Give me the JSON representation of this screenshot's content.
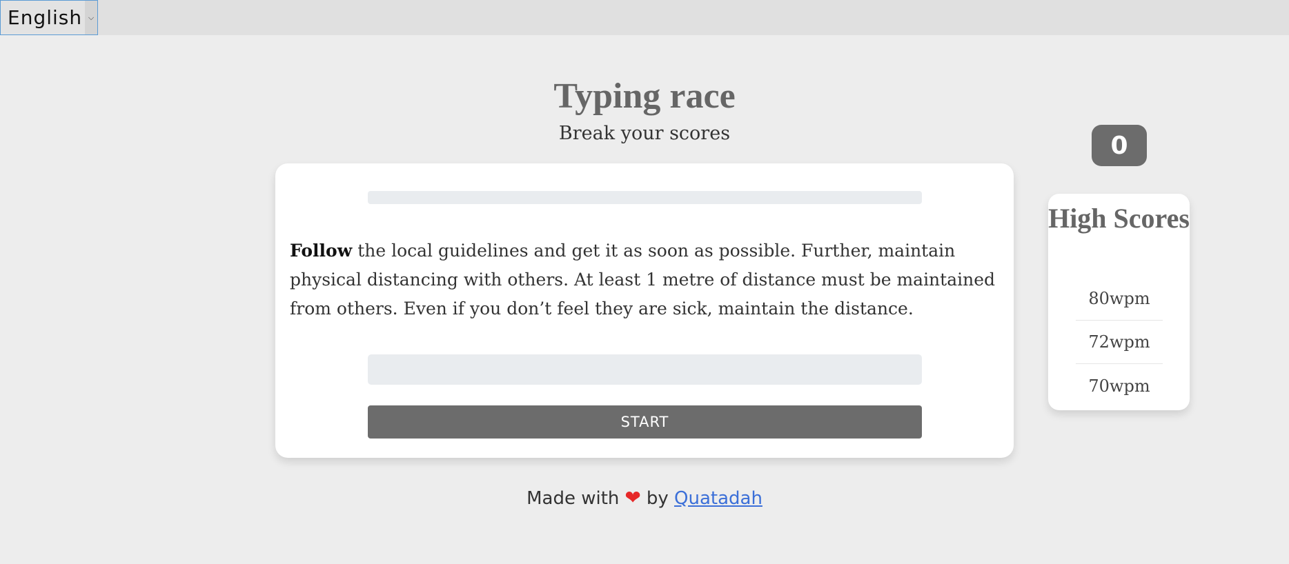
{
  "language": {
    "selected": "English",
    "chevron_icon": "chevron-down-icon"
  },
  "header": {
    "title": "Typing race",
    "subtitle": "Break your scores"
  },
  "race": {
    "progress_fraction": 0,
    "passage_current_word": "Follow",
    "passage_rest": " the local guidelines and get it as soon as possible. Further, maintain physical distancing with others. At least 1 metre of distance must be maintained from others. Even if you don’t feel they are sick, maintain the distance.",
    "input_value": "",
    "start_label": "START"
  },
  "score": {
    "current": "0"
  },
  "high_scores": {
    "title": "High Scores",
    "items": [
      "80wpm",
      "72wpm",
      "70wpm"
    ]
  },
  "footer": {
    "made_with": "Made with",
    "heart_icon": "heart-icon",
    "heart_glyph": "❤",
    "by": "by",
    "author": "Quatadah"
  },
  "colors": {
    "background": "#ededed",
    "accent": "#6c6c6c",
    "link": "#3b6fd8",
    "heart": "#e62828"
  }
}
